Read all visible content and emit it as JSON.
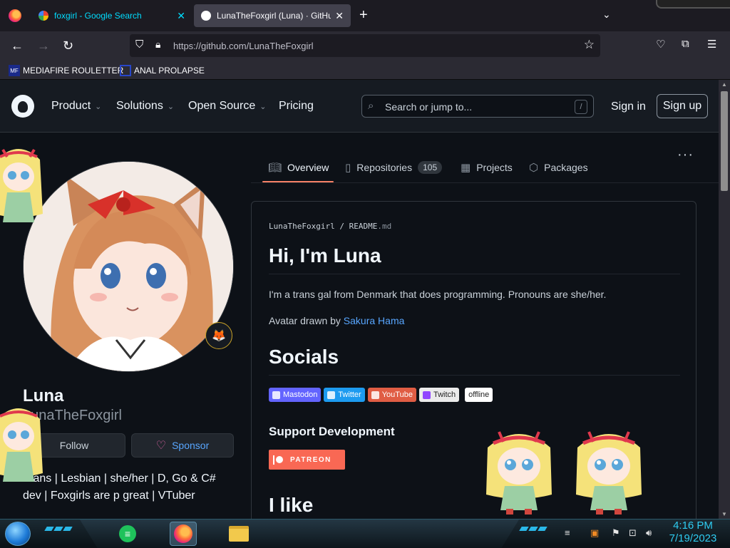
{
  "browser": {
    "tabs": [
      {
        "title": "foxgirl - Google Search",
        "active": false
      },
      {
        "title": "LunaTheFoxgirl (Luna) · GitHub",
        "active": true
      }
    ],
    "new_tab": "+",
    "tab_list": "⌄",
    "url": "https://github.com/LunaTheFoxgirl",
    "bookmarks": [
      {
        "label": "MEDIAFIRE ROULETTER",
        "icon": "mediafire-icon"
      },
      {
        "label": "ANAL PROLAPSE",
        "icon": "sigma-icon"
      }
    ]
  },
  "github_header": {
    "nav": [
      "Product",
      "Solutions",
      "Open Source",
      "Pricing"
    ],
    "search_placeholder": "Search or jump to...",
    "search_shortcut": "/",
    "sign_in": "Sign in",
    "sign_up": "Sign up"
  },
  "profile_tabs": {
    "overview": "Overview",
    "repositories": "Repositories",
    "repositories_count": "105",
    "projects": "Projects",
    "packages": "Packages",
    "more": "···"
  },
  "profile": {
    "name": "Luna",
    "login": "LunaTheFoxgirl",
    "follow": "Follow",
    "sponsor": "Sponsor",
    "bio": "Trans | Lesbian | she/her | D, Go & C# dev | Foxgirls are p great | VTuber",
    "status_emoji": "🦊"
  },
  "readme": {
    "owner": "LunaTheFoxgirl",
    "separator": "/",
    "file": "README",
    "ext": ".md",
    "h1": "Hi, I'm Luna",
    "intro": "I'm a trans gal from Denmark that does programming. Pronouns are she/her.",
    "avatar_credit_prefix": "Avatar drawn by ",
    "avatar_credit_link": "Sakura Hama",
    "socials_heading": "Socials",
    "badges": [
      {
        "label": "Mastodon",
        "color": "#6364ff"
      },
      {
        "label": "Twitter",
        "color": "#1d9bf0"
      },
      {
        "label": "YouTube",
        "color": "#e05d44"
      },
      {
        "label": "Twitch",
        "color": "#ebebeb"
      },
      {
        "label": "offline",
        "color": "#ffffff"
      }
    ],
    "support_heading": "Support Development",
    "patreon": "PATREON",
    "ilike_heading": "I like"
  },
  "taskbar": {
    "time": "4:16 PM",
    "date": "7/19/2023"
  },
  "colors": {
    "page_bg": "#0d1117",
    "accent_link": "#58a6ff",
    "tab_underline": "#f78166",
    "clock": "#2ecbf0"
  }
}
